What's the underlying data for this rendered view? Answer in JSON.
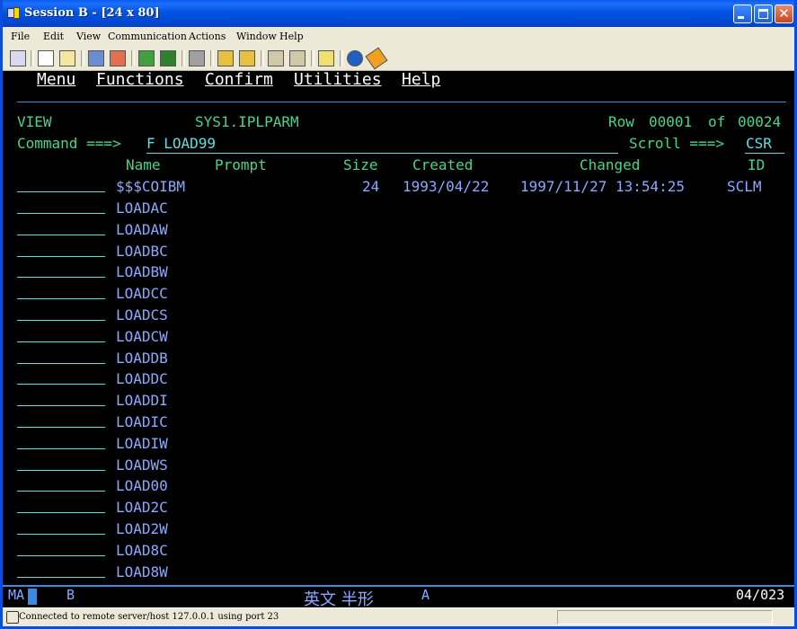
{
  "window": {
    "title": "Session B - [24 x 80]"
  },
  "menubar": [
    "File",
    "Edit",
    "View",
    "Communication",
    "Actions",
    "Window",
    "Help"
  ],
  "toolbar": {
    "icons": [
      "copy-icon",
      "cut-icon",
      "paste-icon",
      "transfer-icon",
      "receive-icon",
      "display-icon",
      "keyboard-icon",
      "print-icon",
      "record-icon",
      "playback-icon",
      "macro-icon",
      "macro-stop-icon",
      "clipboard-icon",
      "globe-icon",
      "tag-icon"
    ]
  },
  "terminal": {
    "action_bar": [
      "Menu",
      "Functions",
      "Confirm",
      "Utilities",
      "Help"
    ],
    "mode": "VIEW",
    "dataset": "SYS1.IPLPARM",
    "row_label": "Row",
    "row_current": "00001",
    "row_of": "of",
    "row_total": "00024",
    "command_label": "Command ===>",
    "command_value": "F LOAD99",
    "scroll_label": "Scroll ===>",
    "scroll_value": "CSR",
    "columns": {
      "name": "Name",
      "prompt": "Prompt",
      "size": "Size",
      "created": "Created",
      "changed": "Changed",
      "id": "ID"
    },
    "first_row": {
      "name": "$$$COIBM",
      "size": "24",
      "created": "1993/04/22",
      "changed": "1997/11/27 13:54:25",
      "id": "SCLM"
    },
    "members": [
      "LOADAC",
      "LOADAW",
      "LOADBC",
      "LOADBW",
      "LOADCC",
      "LOADCS",
      "LOADCW",
      "LOADDB",
      "LOADDC",
      "LOADDI",
      "LOADIC",
      "LOADIW",
      "LOADWS",
      "LOAD00",
      "LOAD2C",
      "LOAD2W",
      "LOAD8C",
      "LOAD8W"
    ]
  },
  "oia": {
    "left": "MA",
    "session": "B",
    "ime": "英文 半形",
    "ime_mode": "A",
    "cursor_pos": "04/023"
  },
  "statusbar": {
    "message": "Connected to remote server/host 127.0.0.1 using port 23"
  },
  "colors": {
    "titlebar": "#0054e3",
    "terminal_bg": "#000000",
    "green": "#49d48b",
    "turquoise": "#5ee0e0",
    "blue": "#8ca8ff",
    "white": "#ffffff"
  }
}
